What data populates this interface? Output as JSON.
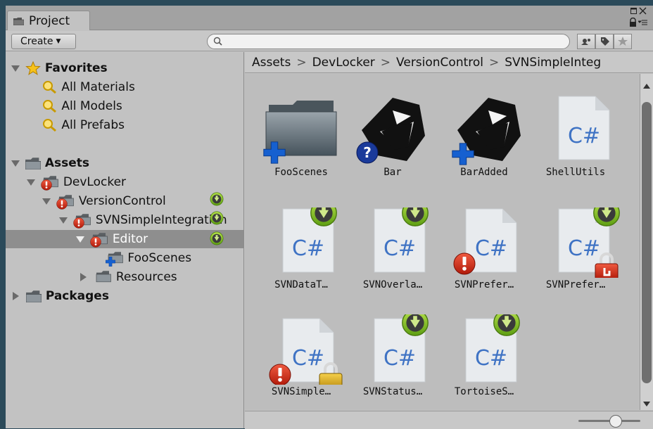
{
  "tab": {
    "label": "Project"
  },
  "toolbar": {
    "create_label": "Create",
    "search_placeholder": ""
  },
  "tree": {
    "favorites": "Favorites",
    "all_materials": "All Materials",
    "all_models": "All Models",
    "all_prefabs": "All Prefabs",
    "assets": "Assets",
    "devlocker": "DevLocker",
    "versioncontrol": "VersionControl",
    "svnsimple": "SVNSimpleIntegration",
    "editor": "Editor",
    "fooscenes": "FooScenes",
    "resources": "Resources",
    "packages": "Packages"
  },
  "breadcrumb": [
    "Assets",
    "DevLocker",
    "VersionControl",
    "SVNSimpleInteg"
  ],
  "assets": [
    {
      "label": "FooScenes",
      "icon": "folder-icon"
    },
    {
      "label": "Bar",
      "icon": "unity-scene-icon"
    },
    {
      "label": "BarAdded",
      "icon": "unity-scene-icon"
    },
    {
      "label": "ShellUtils",
      "icon": "csharp-script-icon"
    },
    {
      "label": "SVNDataT…",
      "icon": "csharp-script-icon"
    },
    {
      "label": "SVNOverla…",
      "icon": "csharp-script-icon"
    },
    {
      "label": "SVNPrefer…",
      "icon": "csharp-script-icon"
    },
    {
      "label": "SVNPrefer…",
      "icon": "csharp-script-icon"
    },
    {
      "label": "SVNSimple…",
      "icon": "csharp-script-icon"
    },
    {
      "label": "SVNStatus…",
      "icon": "csharp-script-icon"
    },
    {
      "label": "TortoiseS…",
      "icon": "csharp-script-icon"
    }
  ],
  "colors": {
    "selection": "#8e8e8e",
    "cs_text": "#3f73c4",
    "conflict": "#cc2a1a",
    "incoming": "#7cc41e",
    "added": "#1660d0"
  }
}
